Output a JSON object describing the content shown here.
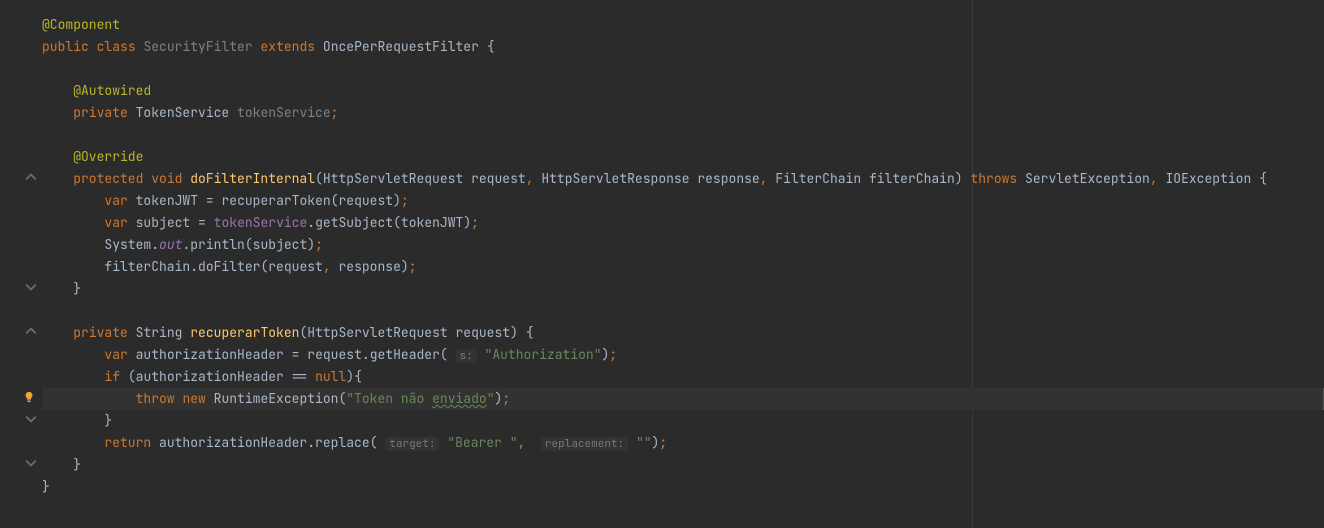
{
  "code": {
    "l1_annotation": "@Component",
    "l2_public": "public",
    "l2_class": "class",
    "l2_name": "SecurityFilter",
    "l2_extends": "extends",
    "l2_parent": "OncePerRequestFilter",
    "l2_brace": " {",
    "l3_autowired": "@Autowired",
    "l4_private": "private",
    "l4_type": "TokenService",
    "l4_field": "tokenService",
    "l4_end": ";",
    "l5_override": "@Override",
    "l6_protected": "protected",
    "l6_void": "void",
    "l6_method": "doFilterInternal",
    "l6_p1t": "HttpServletRequest",
    "l6_p1n": "request",
    "l6_p2t": "HttpServletResponse",
    "l6_p2n": "response",
    "l6_p3t": "FilterChain",
    "l6_p3n": "filterChain",
    "l6_throws": "throws",
    "l6_ex1": "ServletException",
    "l6_ex2": "IOException",
    "l6_brace": " {",
    "l7_var": "var",
    "l7_name": "tokenJWT",
    "l7_call": "recuperarToken",
    "l7_arg": "request",
    "l8_var": "var",
    "l8_name": "subject",
    "l8_obj": "tokenService",
    "l8_call": "getSubject",
    "l8_arg": "tokenJWT",
    "l9_sys": "System",
    "l9_out": "out",
    "l9_call": "println",
    "l9_arg": "subject",
    "l10_obj": "filterChain",
    "l10_call": "doFilter",
    "l10_a1": "request",
    "l10_a2": "response",
    "l11_brace": "}",
    "l12_private": "private",
    "l12_type": "String",
    "l12_method": "recuperarToken",
    "l12_pt": "HttpServletRequest",
    "l12_pn": "request",
    "l12_brace": " {",
    "l13_var": "var",
    "l13_name": "authorizationHeader",
    "l13_obj": "request",
    "l13_call": "getHeader",
    "l13_hint": "s:",
    "l13_str": "\"Authorization\"",
    "l14_if": "if",
    "l14_var": "authorizationHeader",
    "l14_eq": "==",
    "l14_null": "null",
    "l15_throw": "throw",
    "l15_new": "new",
    "l15_type": "RuntimeException",
    "l15_str_a": "\"Token não ",
    "l15_str_b": "enviado",
    "l15_str_c": "\"",
    "l16_brace": "}",
    "l17_return": "return",
    "l17_obj": "authorizationHeader",
    "l17_call": "replace",
    "l17_hint1": "target:",
    "l17_str1": "\"Bearer \"",
    "l17_hint2": "replacement:",
    "l17_str2": "\"\"",
    "l18_brace": "}",
    "l19_brace": "}"
  }
}
